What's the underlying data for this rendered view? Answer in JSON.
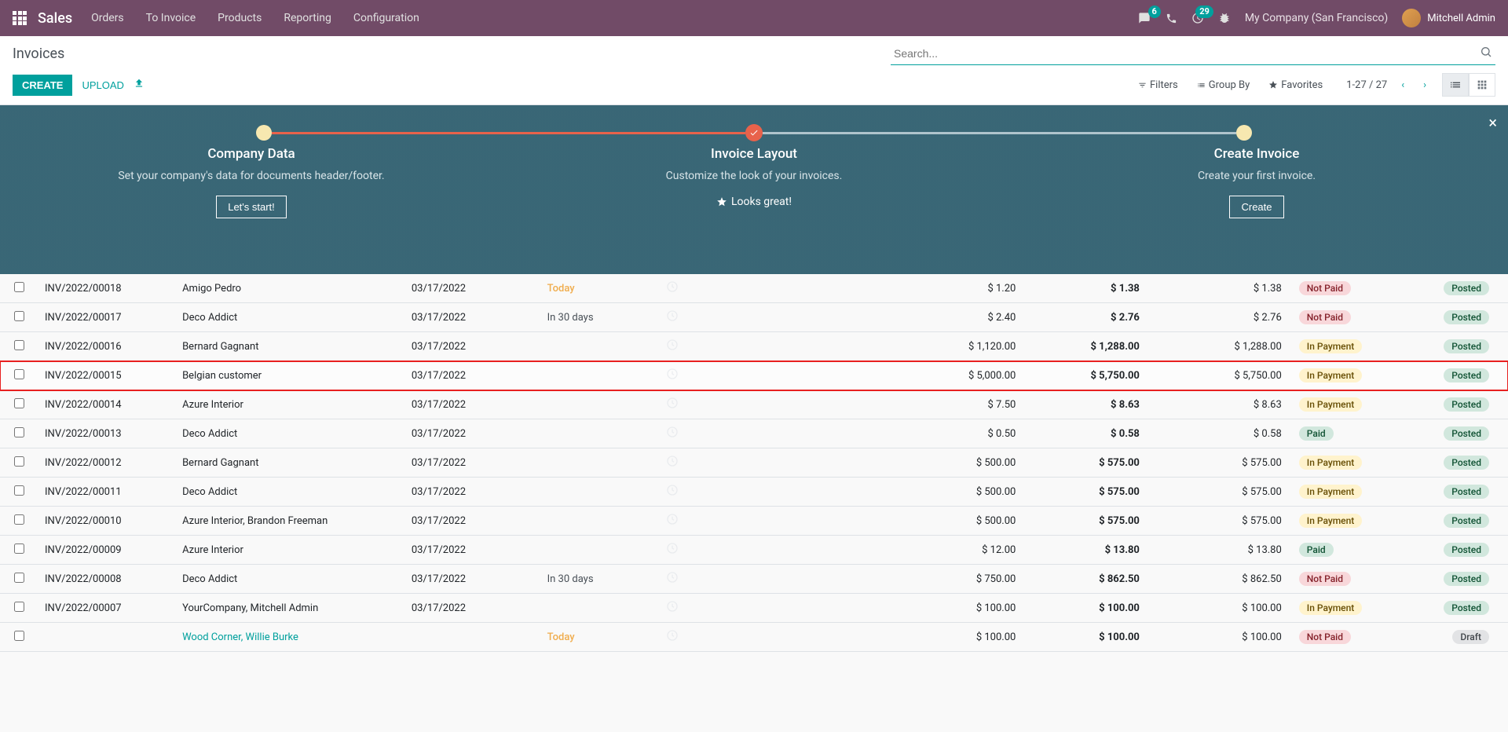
{
  "nav": {
    "brand": "Sales",
    "menu": [
      "Orders",
      "To Invoice",
      "Products",
      "Reporting",
      "Configuration"
    ],
    "messages_badge": "6",
    "activities_badge": "29",
    "company": "My Company (San Francisco)",
    "user": "Mitchell Admin"
  },
  "cp": {
    "title": "Invoices",
    "create": "CREATE",
    "upload": "UPLOAD",
    "search_placeholder": "Search...",
    "filters": "Filters",
    "groupby": "Group By",
    "favorites": "Favorites",
    "pager": "1-27 / 27"
  },
  "onboard": {
    "step1_title": "Company Data",
    "step1_desc": "Set your company's data for documents header/footer.",
    "step1_btn": "Let's start!",
    "step2_title": "Invoice Layout",
    "step2_desc": "Customize the look of your invoices.",
    "step2_sub": "Looks great!",
    "step3_title": "Create Invoice",
    "step3_desc": "Create your first invoice.",
    "step3_btn": "Create"
  },
  "rows": [
    {
      "num": "INV/2022/00018",
      "cust": "Amigo Pedro",
      "date": "03/17/2022",
      "due": "Today",
      "due_class": "today",
      "amt": "$ 1.20",
      "total": "$ 1.38",
      "due_amt": "$ 1.38",
      "pay": "Not Paid",
      "pay_class": "bp-notpaid",
      "status": "Posted",
      "status_class": "bp-posted"
    },
    {
      "num": "INV/2022/00017",
      "cust": "Deco Addict",
      "date": "03/17/2022",
      "due": "In 30 days",
      "amt": "$ 2.40",
      "total": "$ 2.76",
      "due_amt": "$ 2.76",
      "pay": "Not Paid",
      "pay_class": "bp-notpaid",
      "status": "Posted",
      "status_class": "bp-posted"
    },
    {
      "num": "INV/2022/00016",
      "cust": "Bernard Gagnant",
      "date": "03/17/2022",
      "due": "",
      "amt": "$ 1,120.00",
      "total": "$ 1,288.00",
      "due_amt": "$ 1,288.00",
      "pay": "In Payment",
      "pay_class": "bp-inpayment",
      "status": "Posted",
      "status_class": "bp-posted"
    },
    {
      "num": "INV/2022/00015",
      "cust": "Belgian customer",
      "date": "03/17/2022",
      "due": "",
      "amt": "$ 5,000.00",
      "total": "$ 5,750.00",
      "due_amt": "$ 5,750.00",
      "pay": "In Payment",
      "pay_class": "bp-inpayment",
      "status": "Posted",
      "status_class": "bp-posted",
      "highlight": true
    },
    {
      "num": "INV/2022/00014",
      "cust": "Azure Interior",
      "date": "03/17/2022",
      "due": "",
      "amt": "$ 7.50",
      "total": "$ 8.63",
      "due_amt": "$ 8.63",
      "pay": "In Payment",
      "pay_class": "bp-inpayment",
      "status": "Posted",
      "status_class": "bp-posted"
    },
    {
      "num": "INV/2022/00013",
      "cust": "Deco Addict",
      "date": "03/17/2022",
      "due": "",
      "amt": "$ 0.50",
      "total": "$ 0.58",
      "due_amt": "$ 0.58",
      "pay": "Paid",
      "pay_class": "bp-paid",
      "status": "Posted",
      "status_class": "bp-posted"
    },
    {
      "num": "INV/2022/00012",
      "cust": "Bernard Gagnant",
      "date": "03/17/2022",
      "due": "",
      "amt": "$ 500.00",
      "total": "$ 575.00",
      "due_amt": "$ 575.00",
      "pay": "In Payment",
      "pay_class": "bp-inpayment",
      "status": "Posted",
      "status_class": "bp-posted"
    },
    {
      "num": "INV/2022/00011",
      "cust": "Deco Addict",
      "date": "03/17/2022",
      "due": "",
      "amt": "$ 500.00",
      "total": "$ 575.00",
      "due_amt": "$ 575.00",
      "pay": "In Payment",
      "pay_class": "bp-inpayment",
      "status": "Posted",
      "status_class": "bp-posted"
    },
    {
      "num": "INV/2022/00010",
      "cust": "Azure Interior, Brandon Freeman",
      "date": "03/17/2022",
      "due": "",
      "amt": "$ 500.00",
      "total": "$ 575.00",
      "due_amt": "$ 575.00",
      "pay": "In Payment",
      "pay_class": "bp-inpayment",
      "status": "Posted",
      "status_class": "bp-posted"
    },
    {
      "num": "INV/2022/00009",
      "cust": "Azure Interior",
      "date": "03/17/2022",
      "due": "",
      "amt": "$ 12.00",
      "total": "$ 13.80",
      "due_amt": "$ 13.80",
      "pay": "Paid",
      "pay_class": "bp-paid",
      "status": "Posted",
      "status_class": "bp-posted"
    },
    {
      "num": "INV/2022/00008",
      "cust": "Deco Addict",
      "date": "03/17/2022",
      "due": "In 30 days",
      "amt": "$ 750.00",
      "total": "$ 862.50",
      "due_amt": "$ 862.50",
      "pay": "Not Paid",
      "pay_class": "bp-notpaid",
      "status": "Posted",
      "status_class": "bp-posted"
    },
    {
      "num": "INV/2022/00007",
      "cust": "YourCompany, Mitchell Admin",
      "date": "03/17/2022",
      "due": "",
      "amt": "$ 100.00",
      "total": "$ 100.00",
      "due_amt": "$ 100.00",
      "pay": "In Payment",
      "pay_class": "bp-inpayment",
      "status": "Posted",
      "status_class": "bp-posted"
    },
    {
      "num": "",
      "cust": "Wood Corner, Willie Burke",
      "cust_link": true,
      "date": "",
      "due": "Today",
      "due_class": "today",
      "amt": "$ 100.00",
      "total": "$ 100.00",
      "due_amt": "$ 100.00",
      "pay": "Not Paid",
      "pay_class": "bp-notpaid",
      "status": "Draft",
      "status_class": "bp-draft"
    }
  ]
}
